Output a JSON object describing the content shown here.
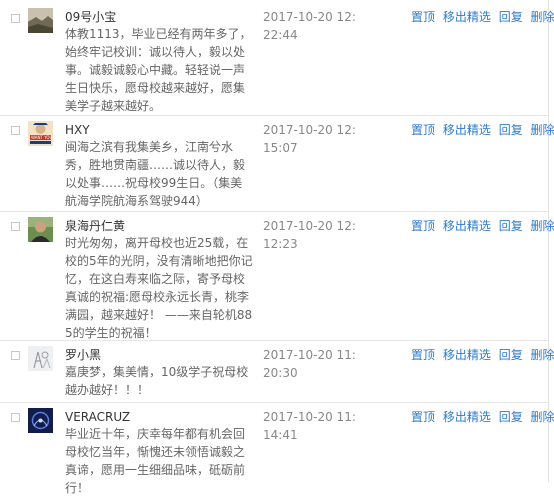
{
  "actions": {
    "pin": "置顶",
    "unfeature": "移出精选",
    "reply": "回复",
    "delete": "删除"
  },
  "comments": [
    {
      "user": "09号小宝",
      "text": "体教1113，毕业已经有两年多了，始终牢记校训：诚以待人，毅以处事。诚毅诚毅心中藏。轻轻说一声生日快乐，愿母校越来越好，愿集美学子越来越好。",
      "time": "2017-10-20 12:22:44",
      "avatar_icon": "landscape-photo-avatar"
    },
    {
      "user": "HXY",
      "text": "闽海之滨有我集美乡，江南兮水秀，胜地贯南疆……诚以待人，毅以处事……祝母校99生日。（集美航海学院航海系驾驶944）",
      "time": "2017-10-20 12:15:07",
      "avatar_icon": "i-want-you-poster-avatar",
      "avatar_text": "I WANT YOU"
    },
    {
      "user": "泉海丹仁黄",
      "text": "时光匆匆，离开母校也近25载，在校的5年的光阴，没有清晰地把你记忆，在这白寿来临之际，寄予母校真诚的祝福:愿母校永远长青，桃李满园，越来越好！ ——来自轮机885的学生的祝福！",
      "time": "2017-10-20 12:12:23",
      "avatar_icon": "person-photo-avatar"
    },
    {
      "user": "罗小黑",
      "text": "嘉庚梦，集美情，10级学子祝母校越办越好！！！",
      "time": "2017-10-20 11:20:30",
      "avatar_icon": "sketch-avatar"
    },
    {
      "user": "VERACRUZ",
      "text": "毕业近十年，庆幸每年都有机会回母校忆当年，惭愧还未领悟诚毅之真谛，愿用一生细细品味，砥砺前行！",
      "time": "2017-10-20 11:14:41",
      "avatar_icon": "night-sky-avatar"
    }
  ]
}
